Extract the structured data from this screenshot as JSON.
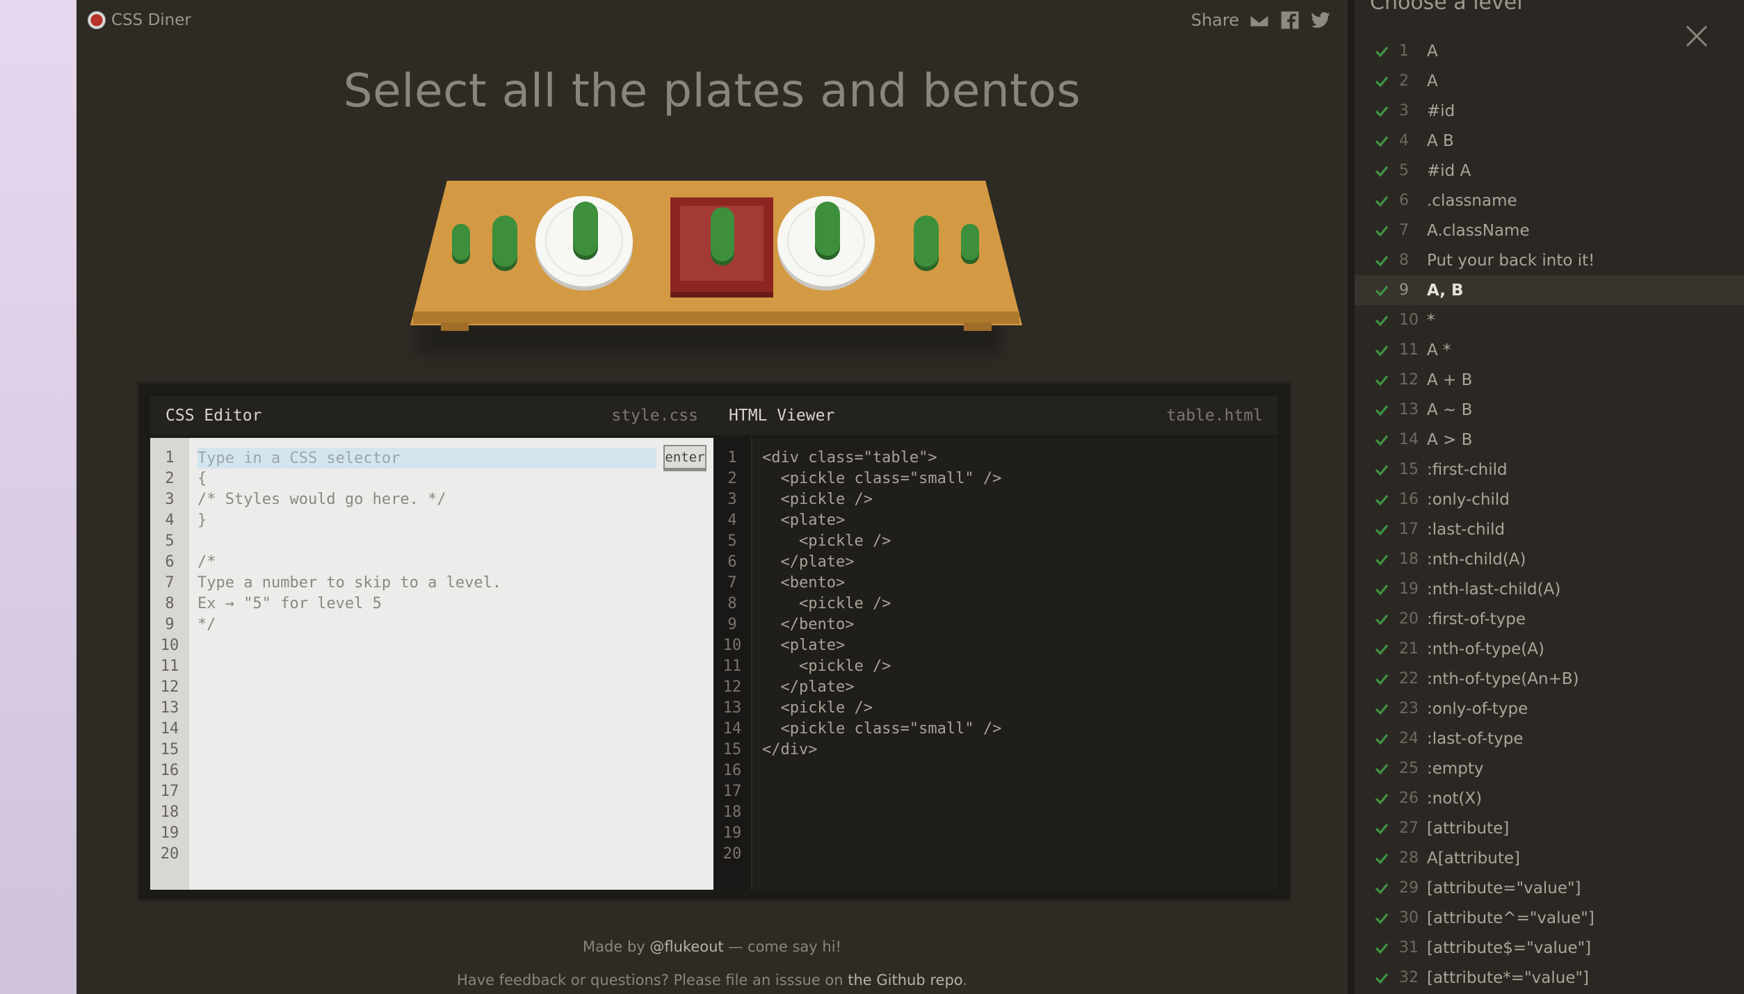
{
  "app": {
    "name": "CSS Diner"
  },
  "share": {
    "label": "Share",
    "icons": [
      "mail-icon",
      "facebook-icon",
      "twitter-icon"
    ]
  },
  "headline": "Select all the plates and bentos",
  "table_items": [
    "pickle-small",
    "pickle",
    "plate-with-pickle",
    "bento-with-pickle",
    "plate-with-pickle",
    "pickle",
    "pickle-small"
  ],
  "css_editor": {
    "title": "CSS Editor",
    "file": "style.css",
    "placeholder": "Type in a CSS selector",
    "enter_label": "enter",
    "code": "\n{\n/* Styles would go here. */\n}\n\n/*\nType a number to skip to a level.\nEx → \"5\" for level 5\n*/",
    "line_numbers": "1\n2\n3\n4\n5\n6\n7\n8\n9\n10\n11\n12\n13\n14\n15\n16\n17\n18\n19\n20"
  },
  "html_viewer": {
    "title": "HTML Viewer",
    "file": "table.html",
    "code": "<div class=\"table\">\n  <pickle class=\"small\" />\n  <pickle />\n  <plate>\n    <pickle />\n  </plate>\n  <bento>\n    <pickle />\n  </bento>\n  <plate>\n    <pickle />\n  </plate>\n  <pickle />\n  <pickle class=\"small\" />\n</div>",
    "line_numbers": "1\n2\n3\n4\n5\n6\n7\n8\n9\n10\n11\n12\n13\n14\n15\n16\n17\n18\n19\n20"
  },
  "footer": {
    "made_by_prefix": "Made by ",
    "made_by_handle": "@flukeout",
    "made_by_suffix": " — come say hi!",
    "feedback_prefix": "Have feedback or questions? Please file an isssue on ",
    "feedback_link": "the Github repo",
    "feedback_suffix": "."
  },
  "sidebar": {
    "title": "Choose a level",
    "active_level": 9,
    "levels": [
      {
        "num": "1",
        "name": "A"
      },
      {
        "num": "2",
        "name": "A"
      },
      {
        "num": "3",
        "name": "#id"
      },
      {
        "num": "4",
        "name": "A  B"
      },
      {
        "num": "5",
        "name": "#id  A"
      },
      {
        "num": "6",
        "name": ".classname"
      },
      {
        "num": "7",
        "name": "A.className"
      },
      {
        "num": "8",
        "name": "Put your back into it!"
      },
      {
        "num": "9",
        "name": "A, B"
      },
      {
        "num": "10",
        "name": "*"
      },
      {
        "num": "11",
        "name": "A  *"
      },
      {
        "num": "12",
        "name": "A + B"
      },
      {
        "num": "13",
        "name": "A ~ B"
      },
      {
        "num": "14",
        "name": "A > B"
      },
      {
        "num": "15",
        "name": ":first-child"
      },
      {
        "num": "16",
        "name": ":only-child"
      },
      {
        "num": "17",
        "name": ":last-child"
      },
      {
        "num": "18",
        "name": ":nth-child(A)"
      },
      {
        "num": "19",
        "name": ":nth-last-child(A)"
      },
      {
        "num": "20",
        "name": ":first-of-type"
      },
      {
        "num": "21",
        "name": ":nth-of-type(A)"
      },
      {
        "num": "22",
        "name": ":nth-of-type(An+B)"
      },
      {
        "num": "23",
        "name": ":only-of-type"
      },
      {
        "num": "24",
        "name": ":last-of-type"
      },
      {
        "num": "25",
        "name": ":empty"
      },
      {
        "num": "26",
        "name": ":not(X)"
      },
      {
        "num": "27",
        "name": "[attribute]"
      },
      {
        "num": "28",
        "name": "A[attribute]"
      },
      {
        "num": "29",
        "name": "[attribute=\"value\"]"
      },
      {
        "num": "30",
        "name": "[attribute^=\"value\"]"
      },
      {
        "num": "31",
        "name": "[attribute$=\"value\"]"
      },
      {
        "num": "32",
        "name": "[attribute*=\"value\"]"
      }
    ]
  }
}
